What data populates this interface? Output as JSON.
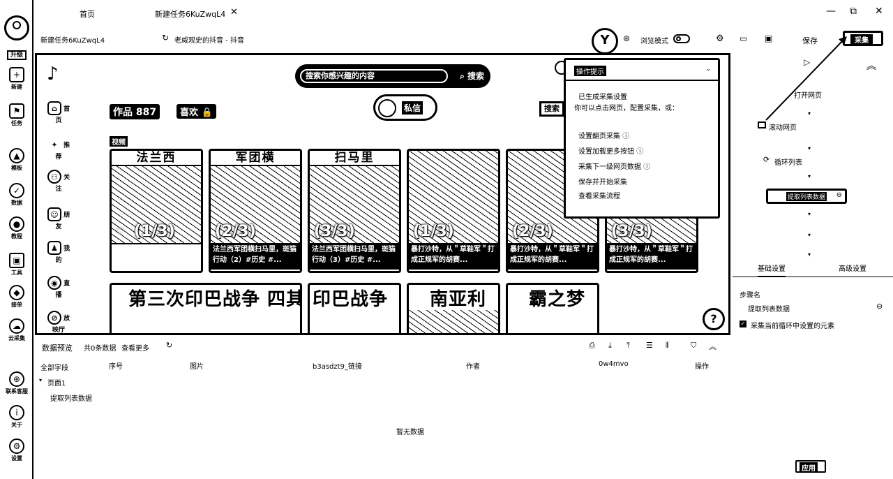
{
  "rail": {
    "upgrade": "升级",
    "items": [
      {
        "label": "新建",
        "icon": "plus-icon"
      },
      {
        "label": "任务",
        "icon": "bookmark-icon"
      },
      {
        "label": "模板",
        "icon": "template-icon"
      },
      {
        "label": "数据",
        "icon": "check-icon"
      },
      {
        "label": "教程",
        "icon": "person-icon"
      },
      {
        "label": "工具",
        "icon": "toolbox-icon"
      },
      {
        "label": "接单",
        "icon": "diamond-icon"
      },
      {
        "label": "云采集",
        "icon": "cloud-icon"
      },
      {
        "label": "联系客服",
        "icon": "service-icon"
      },
      {
        "label": "关于",
        "icon": "info-icon"
      },
      {
        "label": "设置",
        "icon": "gear-icon"
      }
    ]
  },
  "tabs": [
    {
      "label": "首页"
    },
    {
      "label": "新建任务6KuZwqL4",
      "close": "✕"
    }
  ],
  "task_name": "新建任务6KuZwqL4",
  "page_title": "老威观史的抖音 - 抖音",
  "toolbar": {
    "browse_mode": "浏览模式",
    "save": "保存",
    "collect": "采集"
  },
  "tiktok": {
    "search_placeholder": "搜索你感兴趣的内容",
    "search_btn": "搜索",
    "search_btn2": "搜索",
    "works_tab": "作品 887",
    "likes_tab": "喜欢",
    "message_btn": "私信",
    "section_label": "视频",
    "nav": [
      {
        "label": "首页"
      },
      {
        "label": "推荐"
      },
      {
        "label": "关注"
      },
      {
        "label": "朋友"
      },
      {
        "label": "我的"
      },
      {
        "label": "直播"
      },
      {
        "label": "放映厅"
      }
    ],
    "videos": [
      {
        "head": "法兰西",
        "part": "(1/3)",
        "caption": ""
      },
      {
        "head": "军团横",
        "part": "(2/3)",
        "caption": "法兰西军团横扫马里，斑猫行动（2）#历史 #..."
      },
      {
        "head": "扫马里",
        "part": "(3/3)",
        "caption": "法兰西军团横扫马里，斑猫行动（3）#历史 #..."
      },
      {
        "head": "",
        "part": "(1/3)",
        "caption": "暴打沙特，从＂草鞋军＂打成正规军的胡赛..."
      },
      {
        "head": "",
        "part": "(2/3)",
        "caption": "暴打沙特，从＂草鞋军＂打成正规军的胡赛..."
      },
      {
        "head": "",
        "part": "(3/3)",
        "caption": "暴打沙特，从＂草鞋军＂打成正规军的胡赛..."
      }
    ],
    "videos_row2": [
      {
        "text": "第三次印巴战争 四其俱乐部楼谋肢解"
      },
      {
        "text": "印巴战争"
      },
      {
        "text": "南亚利"
      },
      {
        "text": "霸之梦"
      }
    ],
    "help": "?"
  },
  "popup": {
    "title": "操作提示",
    "line1": "已生成采集设置",
    "line2": "你可以点击网页，配置采集，或：",
    "items": [
      "设置翻页采集",
      "设置加载更多按钮",
      "采集下一级网页数据",
      "保存并开始采集",
      "查看采集流程"
    ]
  },
  "flow": {
    "open_page": "打开网页",
    "scroll_page": "滚动网页",
    "loop_list": "循环列表",
    "extract": "提取列表数据"
  },
  "settings": {
    "tab_basic": "基础设置",
    "tab_advanced": "高级设置",
    "step_name_label": "步骤名",
    "step_name_value": "提取列表数据",
    "collect_current": "采集当前循环中设置的元素",
    "apply": "应用"
  },
  "preview": {
    "title": "数据预览",
    "count": "共0条数据",
    "more": "查看更多",
    "all_fields": "全部字段",
    "columns": [
      "序号",
      "图片",
      "b3asdzt9_链接",
      "作者",
      "0w4mvo",
      "操作"
    ],
    "tree_page": "页面1",
    "tree_leaf": "提取列表数据",
    "empty": "暂无数据"
  }
}
